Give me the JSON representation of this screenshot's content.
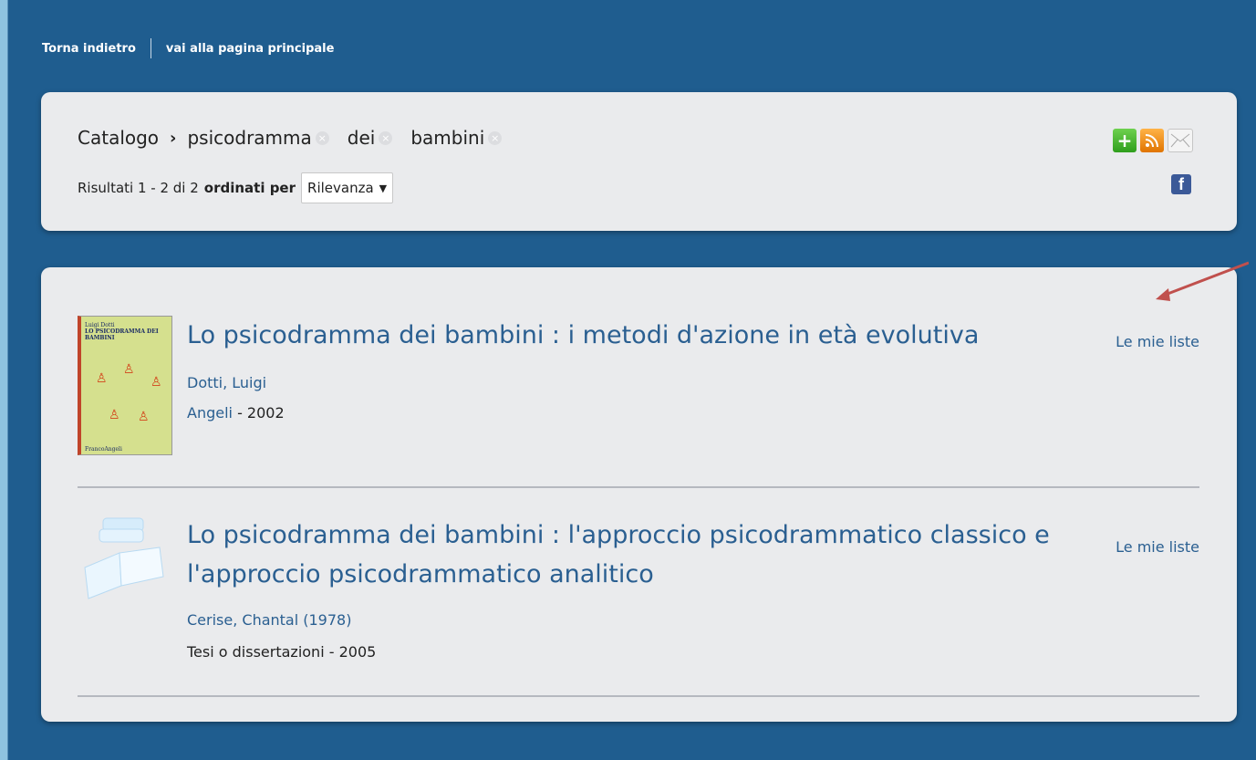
{
  "nav": {
    "back_label": "Torna indietro",
    "home_label": "vai alla pagina principale"
  },
  "search": {
    "catalog_label": "Catalogo",
    "terms": [
      "psicodramma",
      "dei",
      "bambini"
    ],
    "results_text": "Risultati 1 - 2 di 2",
    "sort_label": "ordinati per",
    "sort_value": "Rilevanza"
  },
  "share": {
    "icons": [
      "plus-icon",
      "rss-icon",
      "mail-icon",
      "facebook-icon"
    ]
  },
  "results": [
    {
      "title": "Lo psicodramma dei bambini : i metodi d'azione in età evolutiva",
      "lists_label": "Le mie liste",
      "author": "Dotti, Luigi",
      "publisher": "Angeli",
      "year_suffix": " - 2002",
      "cover": {
        "top_text": "Luigi Dotti",
        "title_text": "LO PSICODRAMMA DEI BAMBINI",
        "bottom_text": "FrancoAngeli"
      }
    },
    {
      "title": "Lo psicodramma dei bambini : l'approccio psicodrammatico classico e l'approccio psicodrammatico analitico",
      "lists_label": "Le mie liste",
      "author": "Cerise, Chantal (1978)",
      "type_year": "Tesi o dissertazioni - 2005"
    }
  ]
}
